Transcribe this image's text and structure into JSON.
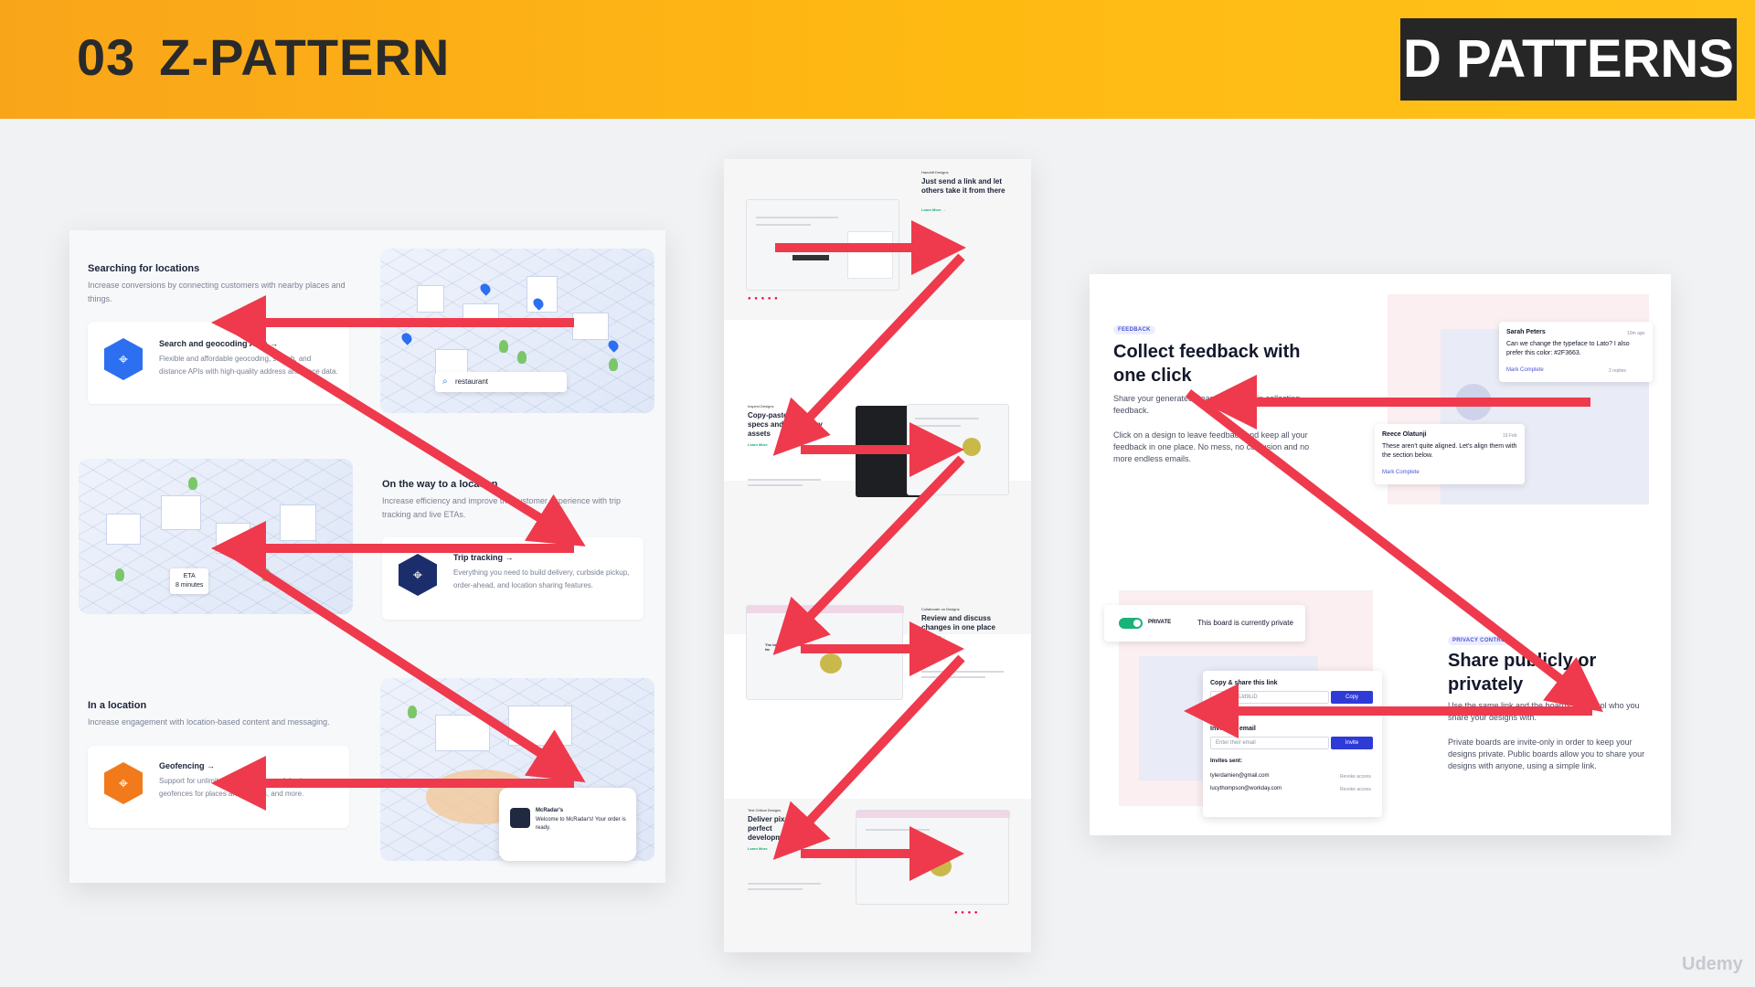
{
  "header": {
    "number": "03",
    "title": "Z-PATTERN",
    "brand": "D PATTERNS",
    "bg_from": "#f9a51a",
    "bg_to": "#ffc21a"
  },
  "left_panel": {
    "section1": {
      "title": "Searching for locations",
      "desc": "Increase conversions by connecting customers with nearby places and things.",
      "card_title": "Search and geocoding APIs →",
      "card_desc": "Flexible and affordable geocoding, search, and distance APIs with high-quality address and place data.",
      "search_value": "restaurant"
    },
    "section2": {
      "title": "On the way to a location",
      "desc": "Increase efficiency and improve the customer experience with trip tracking and live ETAs.",
      "card_title": "Trip tracking →",
      "card_desc": "Everything you need to build delivery, curbside pickup, order-ahead, and location sharing features.",
      "eta_label": "ETA",
      "eta_value": "8 minutes"
    },
    "section3": {
      "title": "In a location",
      "desc": "Increase engagement with location-based content and messaging.",
      "card_title": "Geofencing →",
      "card_desc": "Support for unlimited geofences, out-of-the-box geofences for places and regions, and more.",
      "notif_title": "McRadar's",
      "notif_text": "Welcome to McRadar's! Your order is ready."
    }
  },
  "middle_panel": {
    "blocks": [
      {
        "tag": "Handoff Designs",
        "heading": "Just send a link and let others take it from there",
        "link": "Learn More →"
      },
      {
        "tag": "Inspect Designs",
        "heading": "Copy-paste CSS & specs and export any assets",
        "link": "Learn More"
      },
      {
        "tag": "Collaborate on Designs",
        "heading": "Review and discuss changes in one place",
        "link": "Learn More →"
      },
      {
        "tag": "Test Critical Designs",
        "heading": "Deliver pixel perfect development",
        "link": "Learn More"
      }
    ],
    "inline_caption": "The best avocados on made so far"
  },
  "right_panel": {
    "badge1": "FEEDBACK",
    "title1": "Collect feedback with one click",
    "text1a": "Share your generated Board link to begin collecting feedback.",
    "text1b": "Click on a design to leave feedback and keep all your feedback in one place. No mess, no confusion and no more endless emails.",
    "comment1": {
      "name": "Sarah Peters",
      "time": "10m ago",
      "text": "Can we change the typeface to Lato? I also prefer this color: #2F3663.",
      "link": "Mark Complete",
      "replies": "2 replies"
    },
    "comment2": {
      "name": "Reece Olatunji",
      "time": "19 Feb",
      "text": "These aren't quite aligned. Let's align them with the section below.",
      "link": "Mark Complete"
    },
    "toggle_label": "PRIVATE",
    "toggle_text": "This board is currently private",
    "share": {
      "copy_label": "Copy & share this link",
      "link_value": "zeplin.io/5Jd9LiD",
      "copy_btn": "Copy",
      "invite_label": "Invite via email",
      "invite_placeholder": "Enter their email",
      "invite_btn": "Invite",
      "invites_sent": "Invites sent:",
      "emails": [
        "tylerdamien@gmail.com",
        "lucythompson@workday.com"
      ],
      "revoke": "Revoke access"
    },
    "badge2": "PRIVACY CONTROL",
    "title2": "Share publicly or privately",
    "text2a": "Use the same link and the boards to control who you share your designs with.",
    "text2b": "Private boards are invite-only in order to keep your designs private. Public boards allow you to share your designs with anyone, using a simple link."
  },
  "watermark": "Udemy",
  "arrow_color": "#ee3a4c"
}
